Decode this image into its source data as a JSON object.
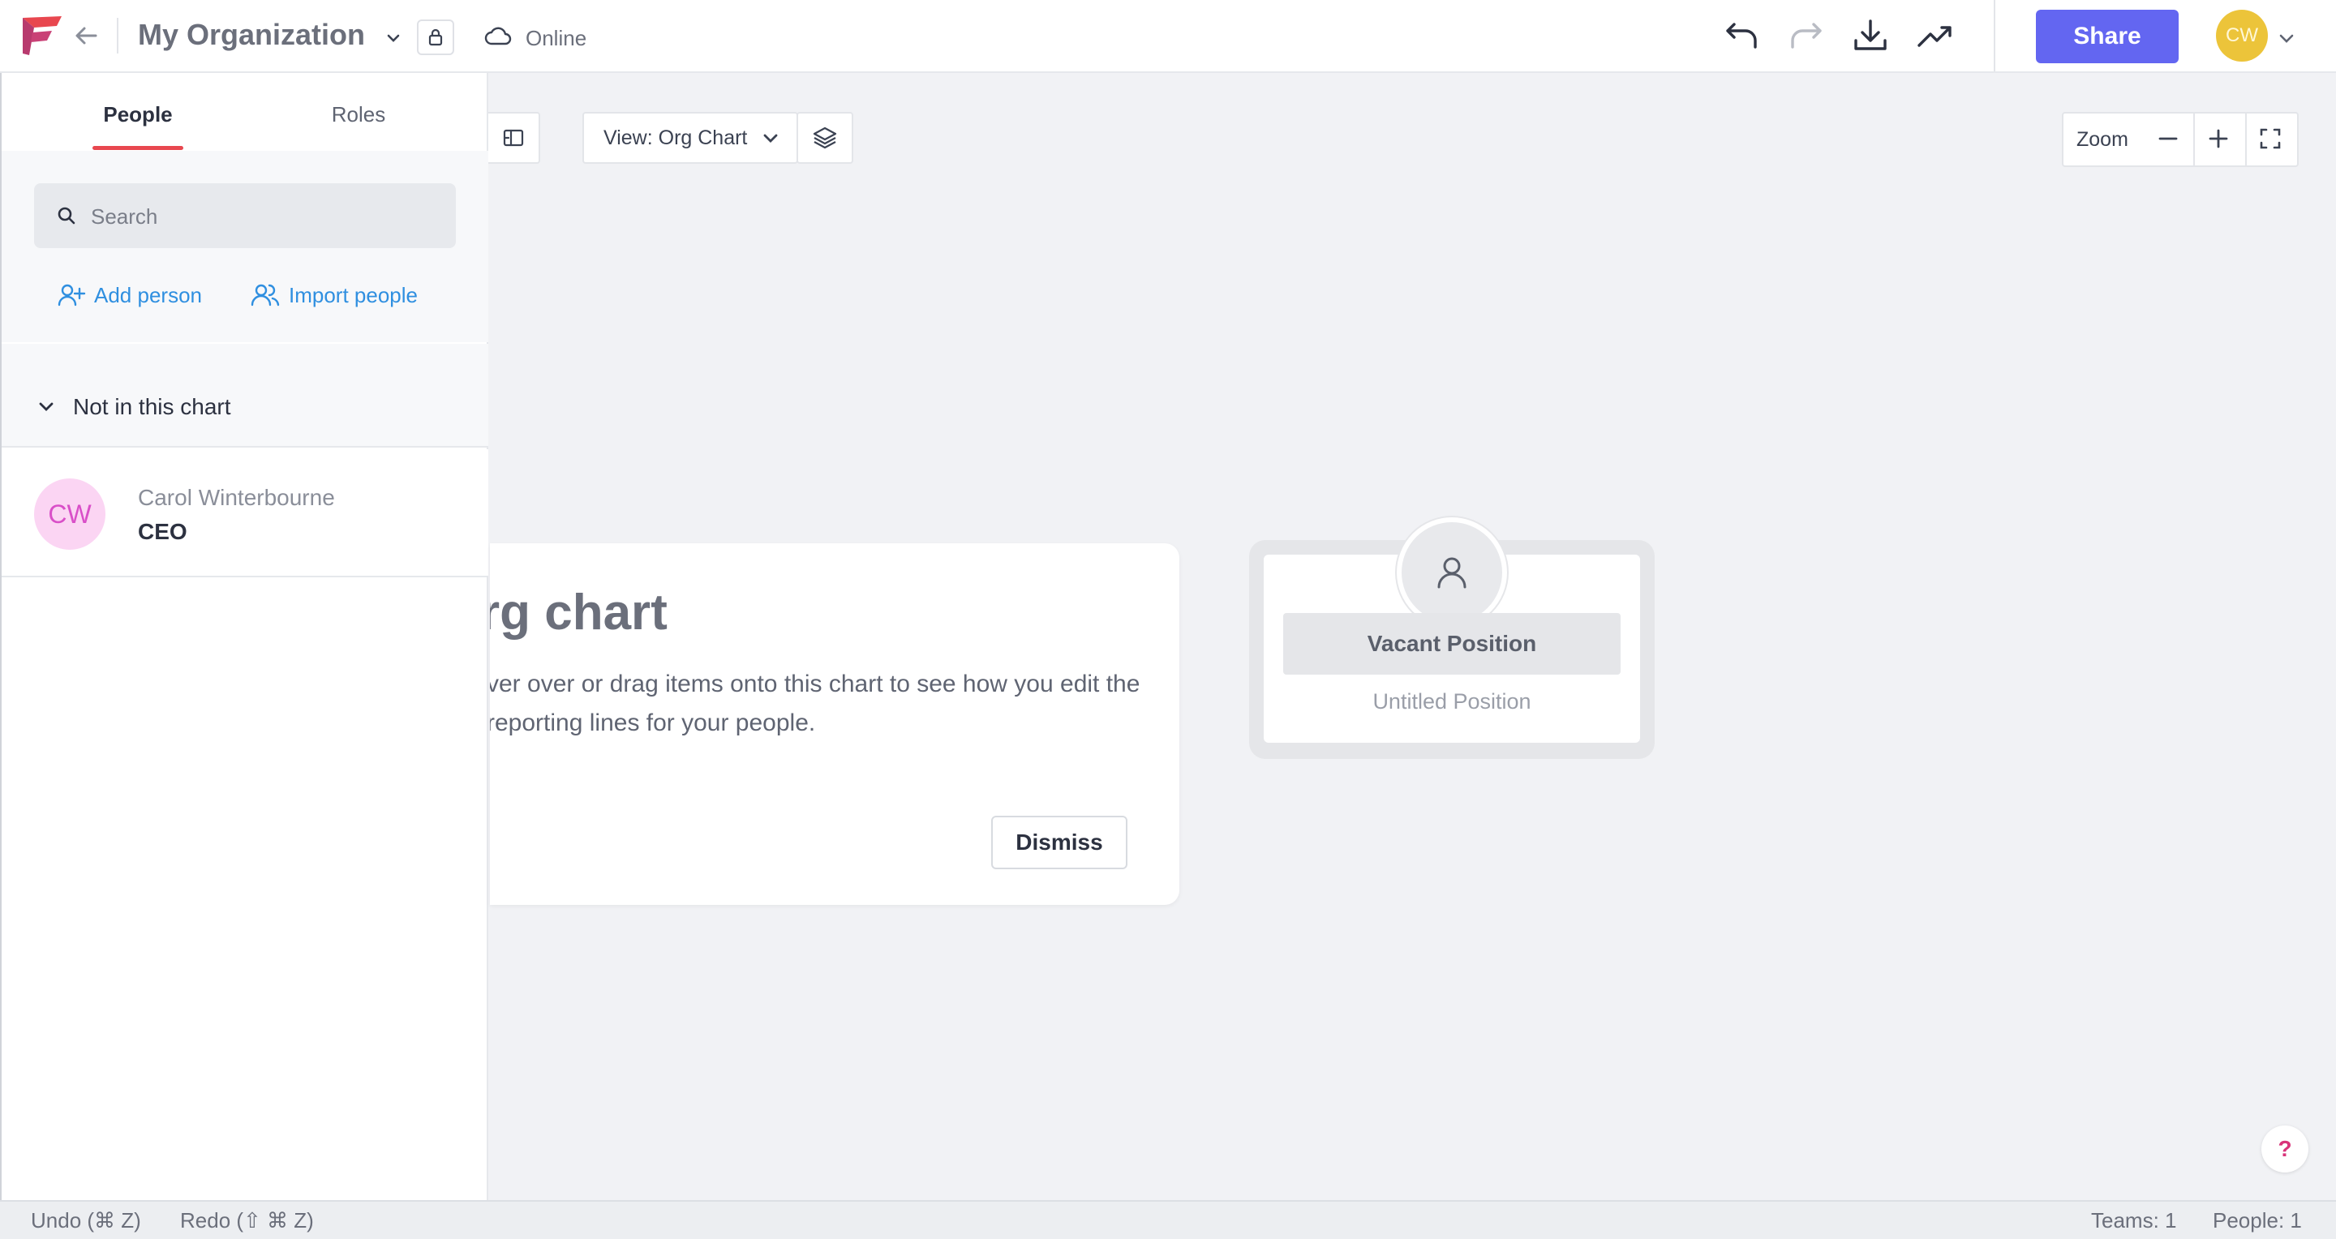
{
  "header": {
    "org_title": "My Organization",
    "status": "Online",
    "share_label": "Share",
    "user_initials": "CW"
  },
  "sidebar": {
    "tabs": [
      {
        "label": "People",
        "active": true
      },
      {
        "label": "Roles",
        "active": false
      }
    ],
    "search": {
      "placeholder": "Search",
      "value": ""
    },
    "add_person": "Add person",
    "import_people": "Import people",
    "section_title": "Not in this chart",
    "people": [
      {
        "initials": "CW",
        "name": "Carol Winterbourne",
        "role": "CEO"
      }
    ]
  },
  "canvas": {
    "view_label": "View: Org Chart",
    "zoom_label": "Zoom",
    "intro": {
      "title": "rg chart",
      "body": "ver over or drag items onto this chart to see how you edit the reporting lines for your people.",
      "dismiss_label": "Dismiss"
    },
    "node": {
      "title": "Vacant Position",
      "subtitle": "Untitled Position"
    },
    "help_label": "?"
  },
  "statusbar": {
    "undo": "Undo (⌘ Z)",
    "redo": "Redo (⇧ ⌘ Z)",
    "teams": "Teams: 1",
    "people": "People: 1"
  },
  "colors": {
    "accent": "#6366f1",
    "tab_underline": "#e8474f",
    "link": "#2f8fe0",
    "avatar_user": "#ecc43a",
    "avatar_person": "#fbd5f3"
  },
  "icons": [
    "logo-icon",
    "back-arrow-icon",
    "chevron-down-icon",
    "lock-icon",
    "cloud-icon",
    "undo-icon",
    "redo-icon",
    "download-icon",
    "trending-icon",
    "search-icon",
    "add-person-icon",
    "import-people-icon",
    "collapse-panel-icon",
    "layers-icon",
    "minus-icon",
    "plus-icon",
    "fullscreen-icon",
    "person-icon",
    "help-icon"
  ]
}
